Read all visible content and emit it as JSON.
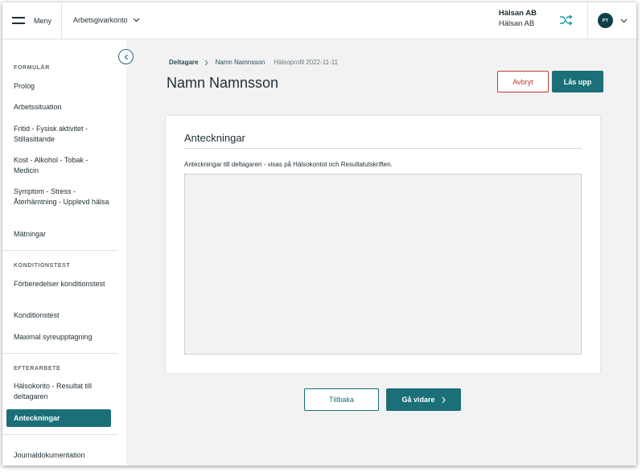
{
  "topbar": {
    "menu_label": "Meny",
    "account_label": "Arbetsgivarkonto",
    "company_name": "Hälsan AB",
    "company_sub": "Hälsan AB",
    "avatar_initials": "PT",
    "switch_icon": "shuffle-icon",
    "accent_color": "#1a9aa6"
  },
  "sidebar": {
    "sections": [
      {
        "title": "FORMULÄR",
        "items": [
          "Prolog",
          "Arbetssituation",
          "Fritid - Fysisk aktivitet - Stillasittande",
          "Kost - Alkohol - Tobak - Medicin",
          "Symptom - Stress - Återhämtning - Upplevd hälsa",
          "Mätningar"
        ]
      },
      {
        "title": "KONDITIONSTEST",
        "items": [
          "Förberedelser konditionstest",
          "Konditionstest",
          "Maximal syreupptagning"
        ]
      },
      {
        "title": "EFTERARBETE",
        "items": [
          "Hälsokonto - Resultat till deltagaren",
          "Anteckningar"
        ]
      }
    ],
    "footer_item": "Journaldokumentation",
    "active_item": "Anteckningar"
  },
  "breadcrumb": {
    "root": "Deltagare",
    "participant": "Namn Namnsson",
    "current": "Hälsoprofil 2022-11-11"
  },
  "page": {
    "title": "Namn Namnsson",
    "cancel_label": "Avbryt",
    "unlock_label": "Lås upp"
  },
  "notes": {
    "title": "Anteckningar",
    "description": "Anteckningar till deltagaren - visas på Hälsokontot och Resultatutskriften.",
    "value": ""
  },
  "footer": {
    "back_label": "Tillbaka",
    "next_label": "Gå vidare"
  },
  "colors": {
    "primary": "#1a6f78",
    "danger": "#c0392b",
    "avatar_bg": "#0f3f45",
    "background": "#f2f2f3"
  }
}
